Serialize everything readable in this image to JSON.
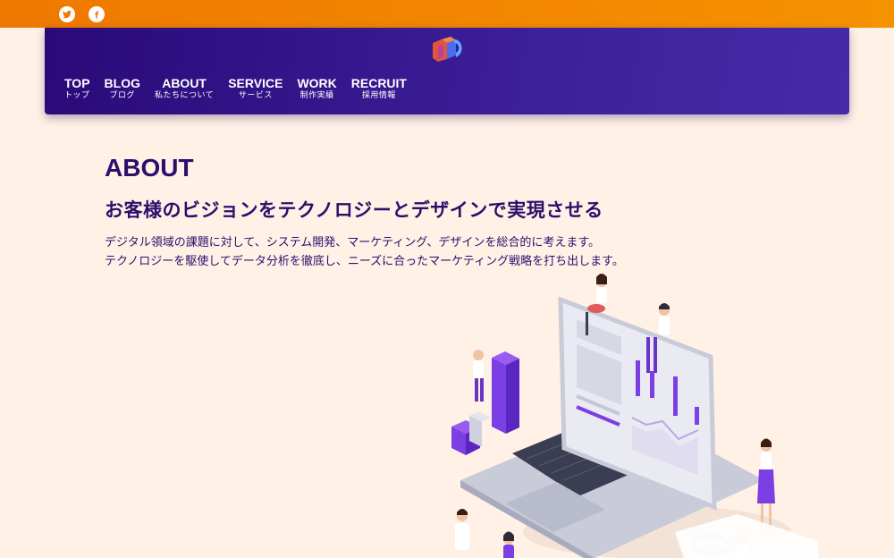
{
  "social": {
    "twitter_icon": "twitter-icon",
    "facebook_icon": "facebook-icon"
  },
  "header": {
    "logo_icon": "company-logo",
    "nav": [
      {
        "en": "TOP",
        "ja": "トップ"
      },
      {
        "en": "BLOG",
        "ja": "ブログ"
      },
      {
        "en": "ABOUT",
        "ja": "私たちについて"
      },
      {
        "en": "SERVICE",
        "ja": "サービス"
      },
      {
        "en": "WORK",
        "ja": "制作実績"
      },
      {
        "en": "RECRUIT",
        "ja": "採用情報"
      }
    ]
  },
  "about": {
    "title": "ABOUT",
    "headline": "お客様のビジョンをテクノロジーとデザインで実現させる",
    "desc_line1": "デジタル領域の課題に対して、システム開発、マーケティング、デザインを総合的に考えます。",
    "desc_line2": "テクノロジーを駆使してデータ分析を徹底し、ニーズに合ったマーケティング戦略を打ち出します。"
  },
  "colors": {
    "topbar": "#ef7800",
    "header": "#2a0a78",
    "text": "#2b0f6b",
    "background": "#fff1e6",
    "accent": "#7b3fe4"
  }
}
